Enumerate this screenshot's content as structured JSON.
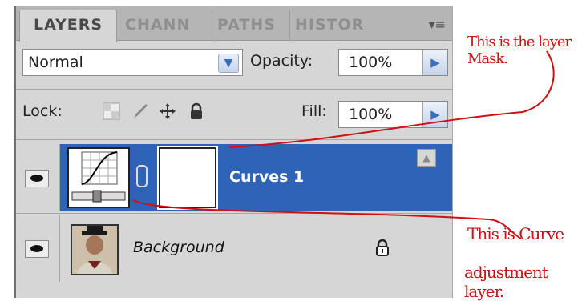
{
  "tabs": [
    "LAYERS",
    "CHANN",
    "PATHS",
    "HISTOR"
  ],
  "panel_menu_icon": "panel-menu-icon",
  "blend_mode": "Normal",
  "opacity": {
    "label": "Opacity:",
    "value": "100%"
  },
  "lock": {
    "label": "Lock:",
    "icons": [
      "lock-transparent-pixels-icon",
      "lock-image-pixels-icon",
      "lock-position-icon",
      "lock-all-icon"
    ]
  },
  "fill": {
    "label": "Fill:",
    "value": "100%"
  },
  "layers": [
    {
      "name": "Curves 1",
      "selected": true
    },
    {
      "name": "Background",
      "selected": false,
      "locked": true
    }
  ],
  "annotations": {
    "mask_note": "This is the layer Mask.",
    "curve_note_line1": "This is Curve",
    "curve_note_line2": "adjustment layer."
  },
  "colors": {
    "selection": "#2f63b8",
    "annotation": "#d01010",
    "panel": "#d6d6d6"
  }
}
